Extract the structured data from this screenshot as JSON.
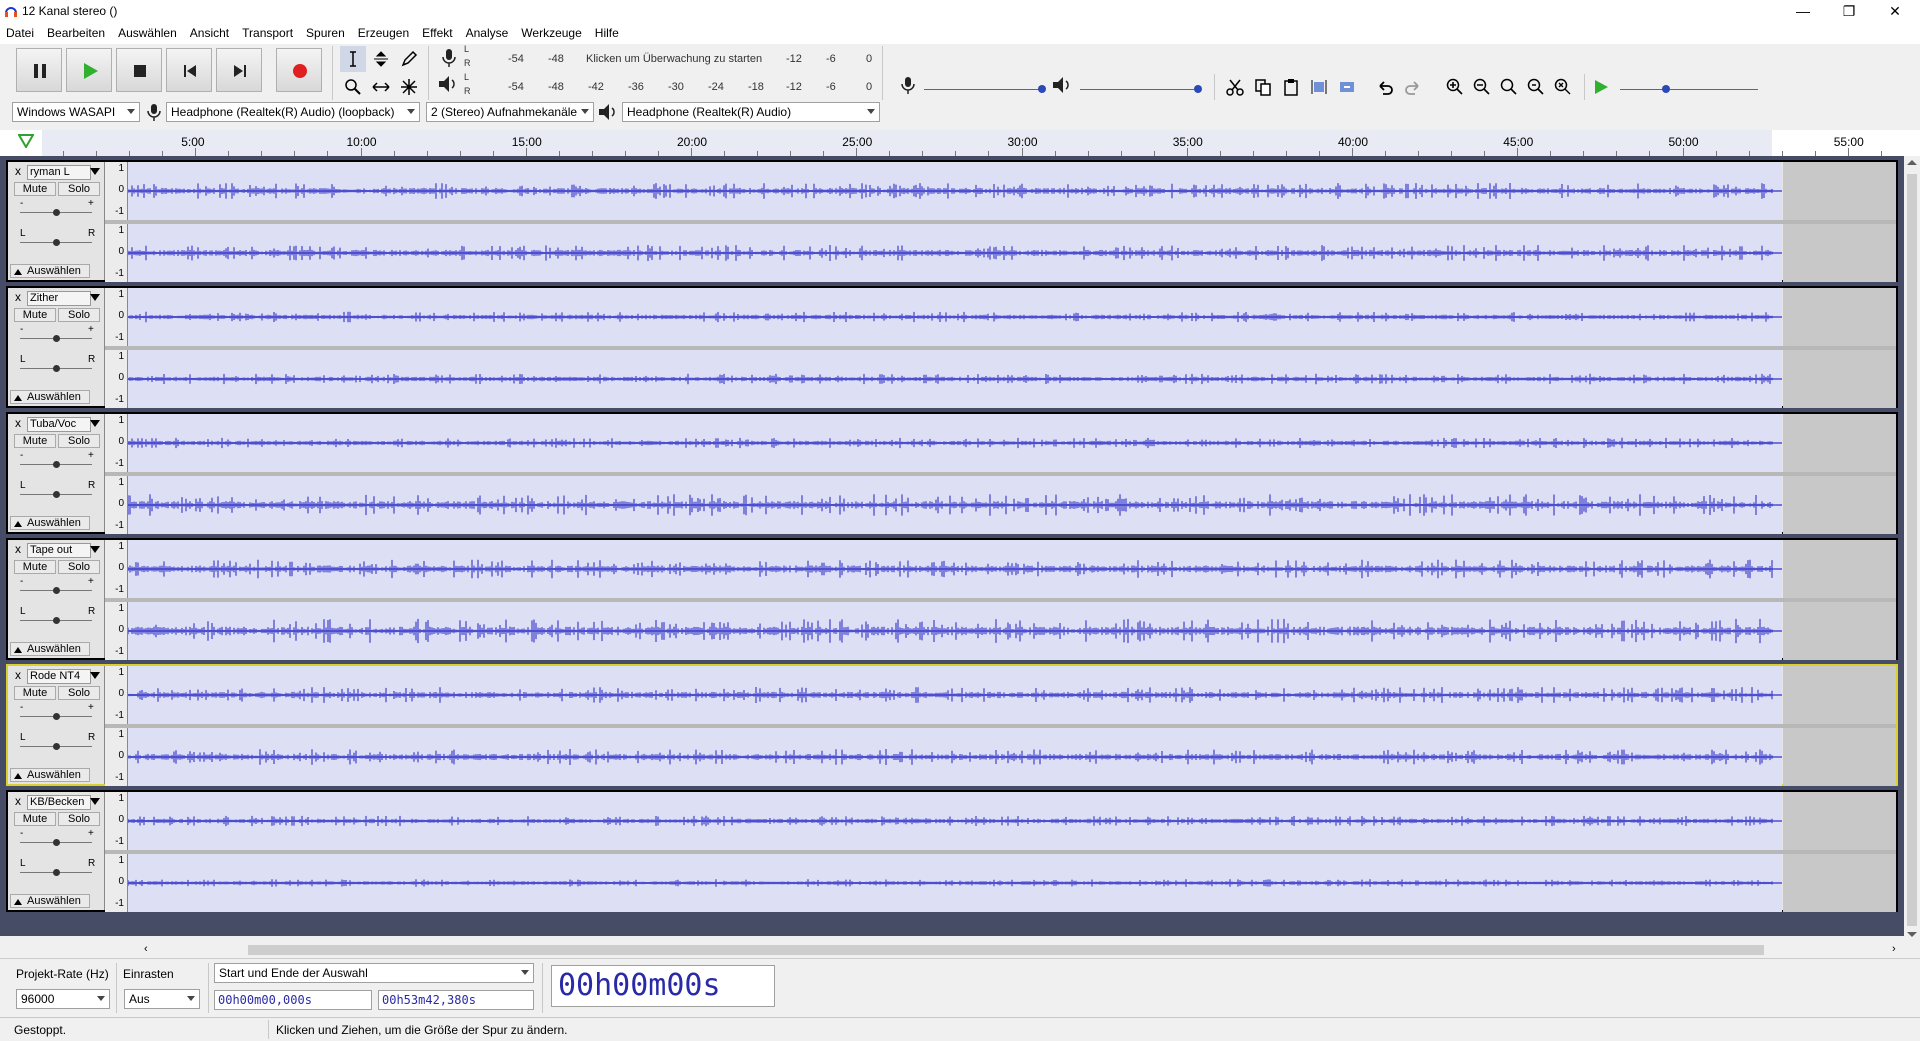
{
  "window": {
    "title": "12 Kanal stereo ()"
  },
  "menu": [
    "Datei",
    "Bearbeiten",
    "Auswählen",
    "Ansicht",
    "Transport",
    "Spuren",
    "Erzeugen",
    "Effekt",
    "Analyse",
    "Werkzeuge",
    "Hilfe"
  ],
  "meters": {
    "record_scale": [
      "-54",
      "-48",
      "Klicken um Überwachung zu starten",
      "-12",
      "-6",
      "0"
    ],
    "play_scale": [
      "-54",
      "-48",
      "-42",
      "-36",
      "-30",
      "-24",
      "-18",
      "-12",
      "-6",
      "0"
    ],
    "L": "L",
    "R": "R"
  },
  "device": {
    "host": "Windows WASAPI",
    "input": "Headphone (Realtek(R) Audio) (loopback)",
    "channels": "2 (Stereo) Aufnahmekanäle",
    "output": "Headphone (Realtek(R) Audio)"
  },
  "ruler": [
    "5:00",
    "10:00",
    "15:00",
    "20:00",
    "25:00",
    "30:00",
    "35:00",
    "40:00",
    "45:00",
    "50:00",
    "55:00"
  ],
  "tracks": [
    {
      "name": "ryman L",
      "focused": false,
      "amp": [
        5,
        5
      ]
    },
    {
      "name": "Zither",
      "focused": false,
      "amp": [
        3,
        3
      ]
    },
    {
      "name": "Tuba/Voc",
      "focused": false,
      "amp": [
        3,
        7
      ]
    },
    {
      "name": "Tape out",
      "focused": false,
      "amp": [
        6,
        8
      ]
    },
    {
      "name": "Rode NT4",
      "focused": true,
      "amp": [
        5,
        5
      ]
    },
    {
      "name": "KB/Becken",
      "focused": false,
      "amp": [
        3,
        2
      ]
    }
  ],
  "trackpanel": {
    "mute": "Mute",
    "solo": "Solo",
    "select": "Auswählen",
    "gain_minus": "-",
    "gain_plus": "+",
    "pan_l": "L",
    "pan_r": "R",
    "close": "x"
  },
  "vruler": {
    "top": "1",
    "mid": "0",
    "bottom": "-1"
  },
  "bottom": {
    "rate_label": "Projekt-Rate (Hz)",
    "rate_value": "96000",
    "snap_label": "Einrasten",
    "snap_value": "Aus",
    "selection_mode": "Start und Ende der Auswahl",
    "sel_start": "00h00m00,000s",
    "sel_end": "00h53m42,380s",
    "position": "00h00m00s"
  },
  "status": {
    "left": "Gestoppt.",
    "main": "Klicken und Ziehen, um die Größe der Spur zu ändern."
  },
  "colors": {
    "wave": "#3232c8",
    "wave_bg": "#dde0f5",
    "track_bg": "#464c66",
    "focus": "#d8d030",
    "record": "#e02020",
    "play": "#30b030"
  }
}
